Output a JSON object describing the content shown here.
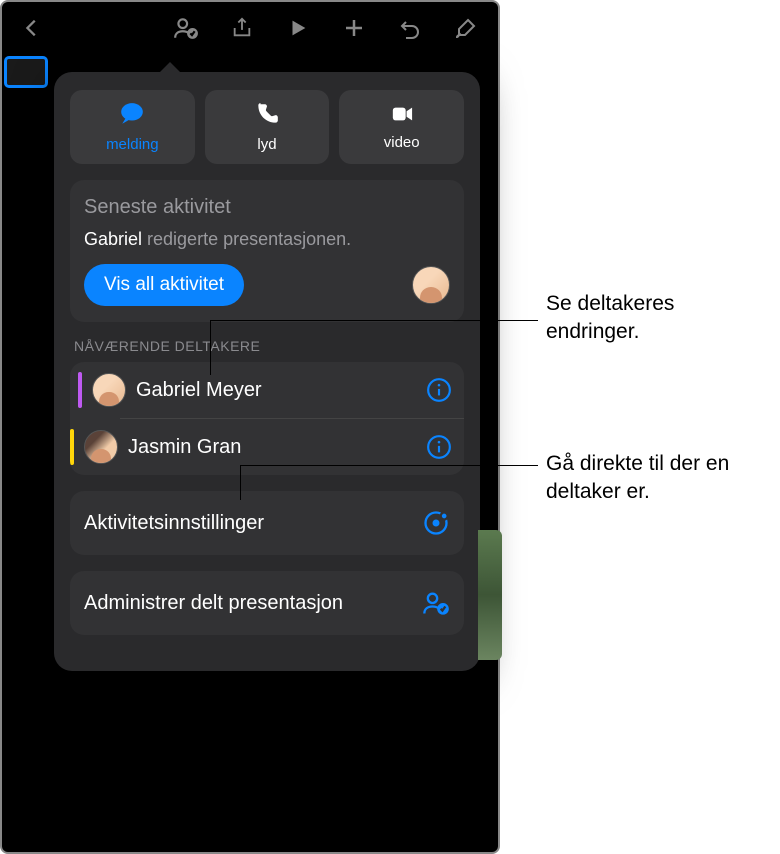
{
  "toolbar": {
    "icons": [
      "back",
      "collaborate",
      "share",
      "play",
      "add",
      "undo",
      "format"
    ]
  },
  "contact": {
    "message": "melding",
    "audio": "lyd",
    "video": "video"
  },
  "latest_activity": {
    "title": "Seneste aktivitet",
    "actor": "Gabriel",
    "action": " redigerte presentasjonen.",
    "show_all": "Vis all aktivitet"
  },
  "participants_section": "NÅVÆRENDE DELTAKERE",
  "participants": [
    {
      "name": "Gabriel Meyer",
      "color": "#bf5af2"
    },
    {
      "name": "Jasmin Gran",
      "color": "#ffd60a"
    }
  ],
  "activity_settings": "Aktivitetsinnstillinger",
  "manage_shared": "Administrer delt presentasjon",
  "callouts": {
    "c1": "Se deltakeres endringer.",
    "c2": "Gå direkte til der en deltaker er."
  }
}
